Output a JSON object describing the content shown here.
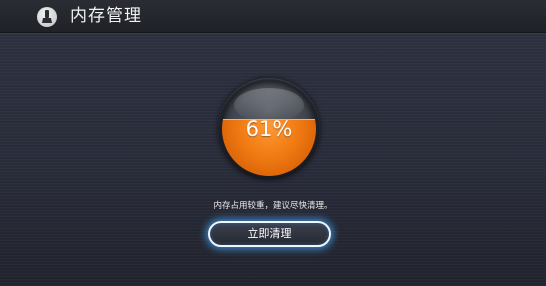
{
  "header": {
    "title": "内存管理",
    "icon": "cleaner-icon"
  },
  "gauge": {
    "percent_text": "61%",
    "fill_fraction": 0.61,
    "fill_color": "#f07a12"
  },
  "message": "内存占用较重，建议尽快清理。",
  "action": {
    "clean_label": "立即清理",
    "glow_color": "#46aaff"
  }
}
